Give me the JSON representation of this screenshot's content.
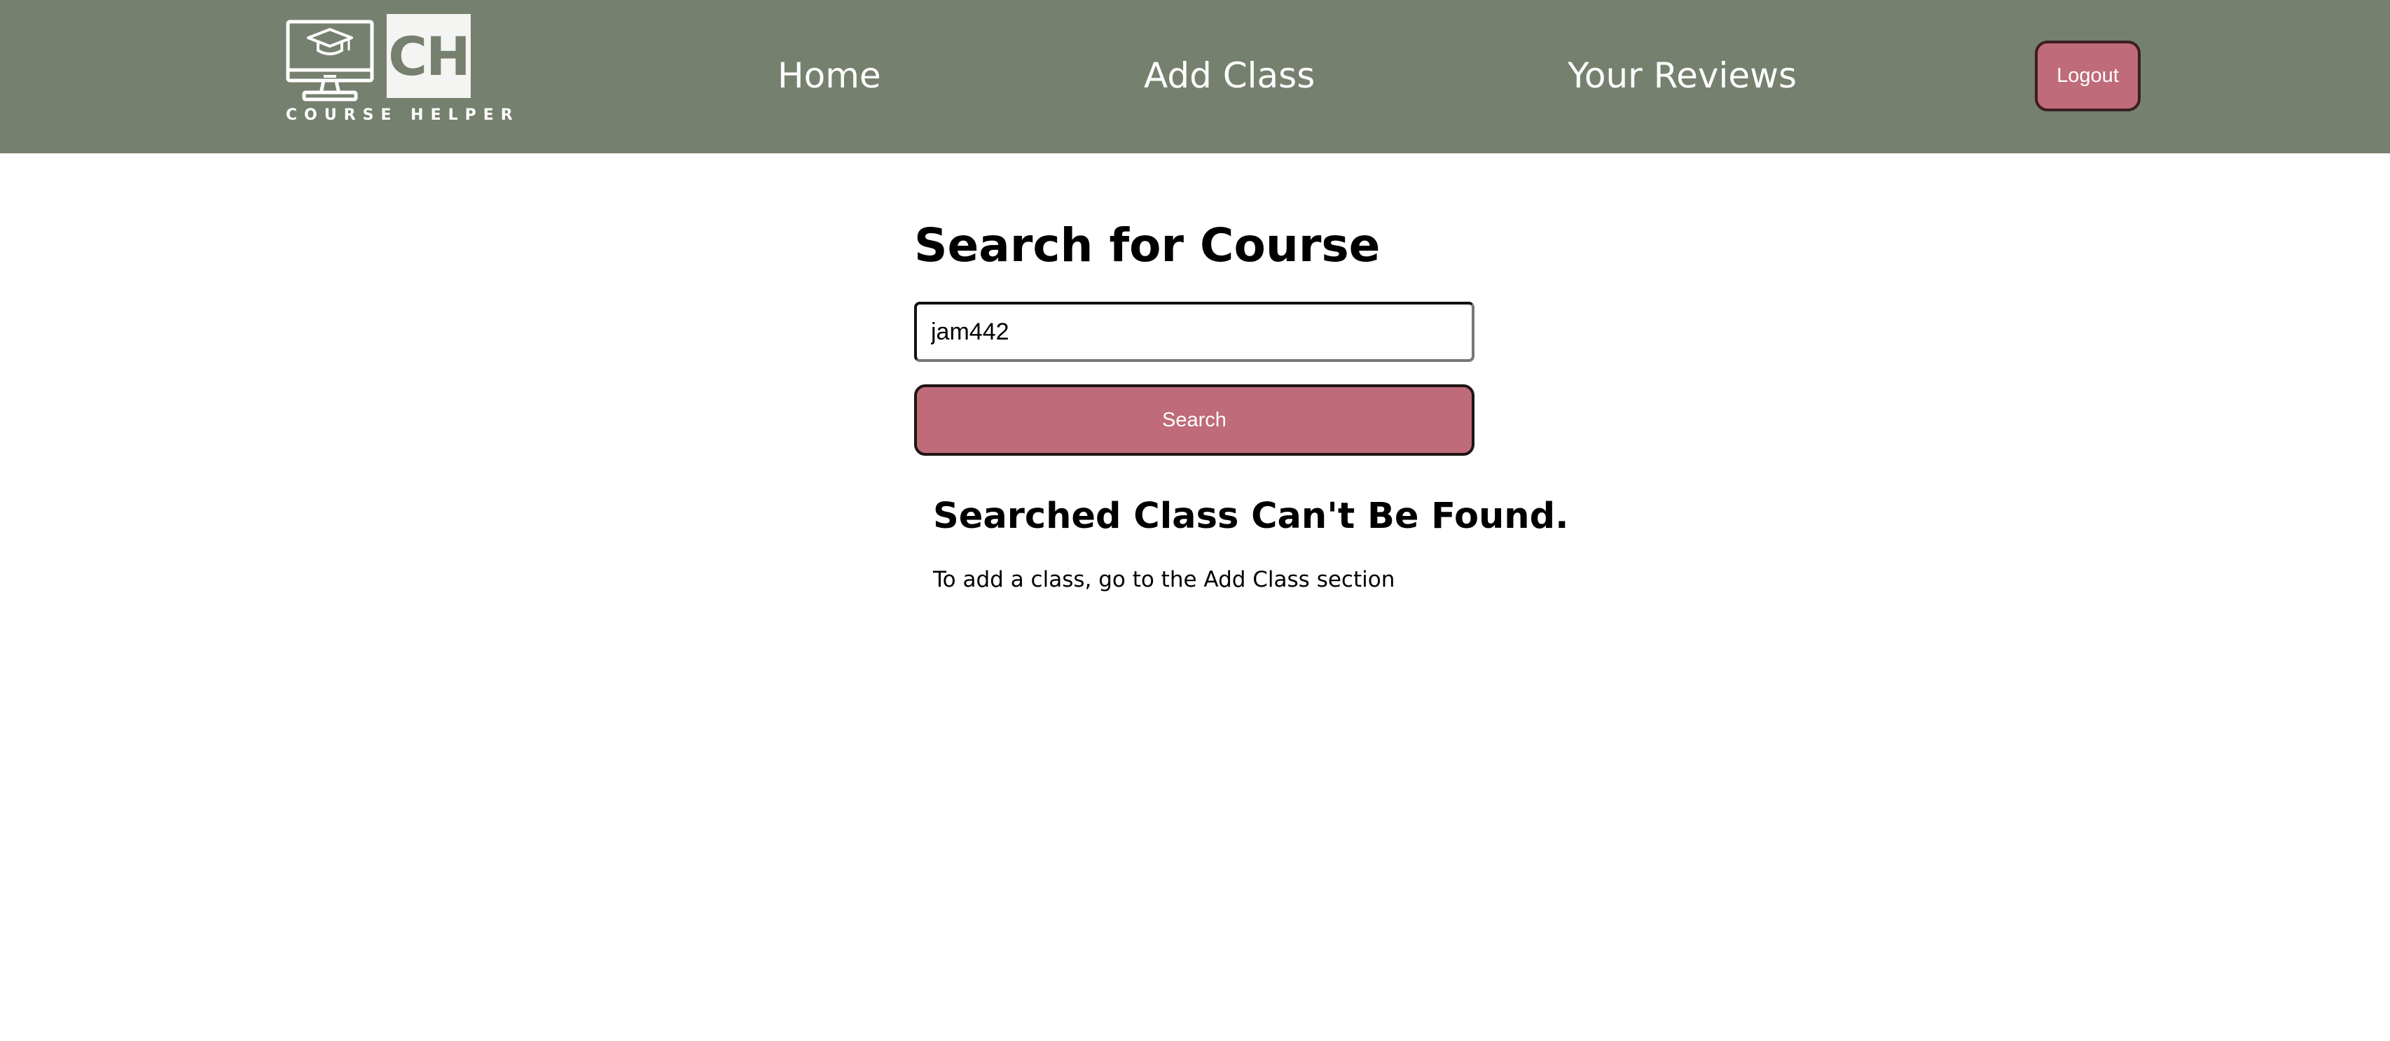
{
  "header": {
    "logo": {
      "letters": "CH",
      "caption": "COURSE HELPER",
      "icon": "graduation-monitor-icon"
    },
    "nav": [
      {
        "label": "Home"
      },
      {
        "label": "Add Class"
      },
      {
        "label": "Your Reviews"
      }
    ],
    "logout_label": "Logout"
  },
  "search": {
    "title": "Search for Course",
    "input_value": "jam442",
    "button_label": "Search"
  },
  "result": {
    "heading": "Searched Class Can't Be Found.",
    "message": "To add a class, go to the Add Class section"
  },
  "colors": {
    "navbar": "#76806e",
    "accent": "#bf6b79",
    "logo_box": "#f4f4f2"
  }
}
